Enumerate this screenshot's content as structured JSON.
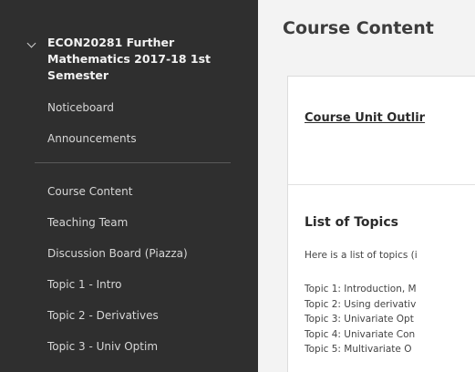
{
  "sidebar": {
    "course_title_lines": [
      "ECON20281 Further",
      "Mathematics 2017-18 1st",
      "Semester"
    ],
    "top_items": [
      {
        "label": "Noticeboard"
      },
      {
        "label": "Announcements"
      }
    ],
    "items": [
      {
        "label": "Course Content"
      },
      {
        "label": "Teaching Team"
      },
      {
        "label": "Discussion Board (Piazza)"
      },
      {
        "label": "Topic 1 - Intro"
      },
      {
        "label": "Topic 2 - Derivatives"
      },
      {
        "label": "Topic 3 - Univ Optim"
      }
    ]
  },
  "main": {
    "page_title": "Course Content",
    "outline_link": "Course Unit Outlir",
    "topics_heading": "List of Topics",
    "topics_intro": "Here is a list of topics (i",
    "topics": [
      "Topic 1: Introduction, M",
      "Topic 2: Using derivativ",
      "Topic 3: Univariate Opt",
      "Topic 4: Univariate Con",
      "Topic 5: Multivariate O"
    ]
  }
}
